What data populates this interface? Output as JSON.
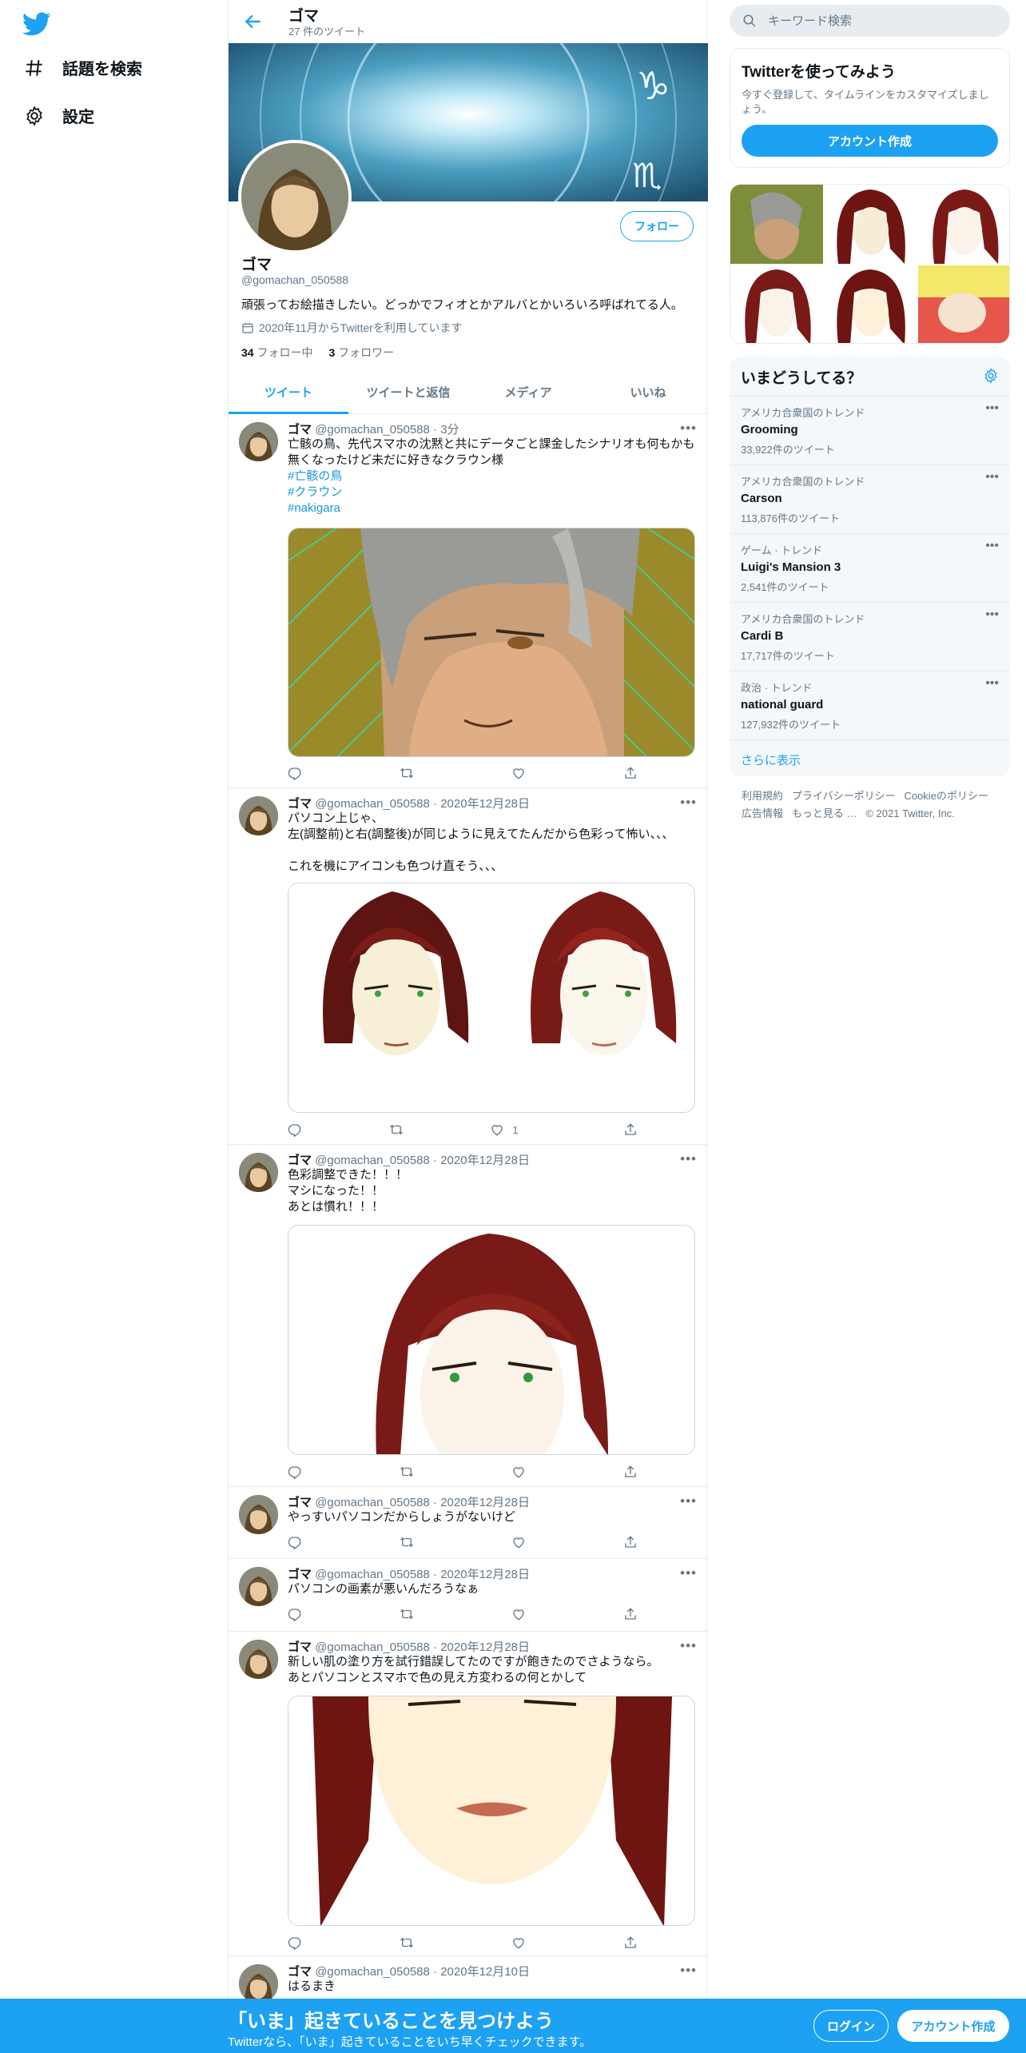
{
  "nav": {
    "search_label": "話題を検索",
    "settings_label": "設定"
  },
  "profile": {
    "name": "ゴマ",
    "tweet_count": "27 件のツイート",
    "handle": "@gomachan_050588",
    "bio": "頑張ってお絵描きしたい。どっかでフィオとかアルバとかいろいろ呼ばれてる人。",
    "joined": "2020年11月からTwitterを利用しています",
    "following_count": "34",
    "following_label": "フォロー中",
    "followers_count": "3",
    "followers_label": "フォロワー",
    "follow_button": "フォロー"
  },
  "tabs": [
    "ツイート",
    "ツイートと返信",
    "メディア",
    "いいね"
  ],
  "tweets": [
    {
      "name": "ゴマ",
      "handle": "@gomachan_050588",
      "time": "3分",
      "text": "亡骸の鳥、先代スマホの沈黙と共にデータごと課金したシナリオも何もかも無くなったけど未だに好きなクラウン様",
      "tags": [
        "#亡骸の鳥",
        "#クラウン",
        "#nakigara"
      ],
      "likes": ""
    },
    {
      "name": "ゴマ",
      "handle": "@gomachan_050588",
      "time": "2020年12月28日",
      "text": "パソコン上じゃ、\n左(調整前)と右(調整後)が同じように見えてたんだから色彩って怖い、、、\n\nこれを機にアイコンも色つけ直そう、、、",
      "likes": "1"
    },
    {
      "name": "ゴマ",
      "handle": "@gomachan_050588",
      "time": "2020年12月28日",
      "text": "色彩調整できた！！！\nマシになった！！\nあとは慣れ！！！",
      "likes": ""
    },
    {
      "name": "ゴマ",
      "handle": "@gomachan_050588",
      "time": "2020年12月28日",
      "text": "やっすいパソコンだからしょうがないけど",
      "likes": ""
    },
    {
      "name": "ゴマ",
      "handle": "@gomachan_050588",
      "time": "2020年12月28日",
      "text": "パソコンの画素が悪いんだろうなぁ",
      "likes": ""
    },
    {
      "name": "ゴマ",
      "handle": "@gomachan_050588",
      "time": "2020年12月28日",
      "text": "新しい肌の塗り方を試行錯誤してたのですが飽きたのでさようなら。\nあとパソコンとスマホで色の見え方変わるの何とかして",
      "likes": ""
    },
    {
      "name": "ゴマ",
      "handle": "@gomachan_050588",
      "time": "2020年12月10日",
      "text": "はるまき",
      "likes": ""
    }
  ],
  "search": {
    "placeholder": "キーワード検索"
  },
  "signup": {
    "title": "Twitterを使ってみよう",
    "desc": "今すぐ登録して、タイムラインをカスタマイズしましょう。",
    "button": "アカウント作成"
  },
  "trends": {
    "title": "いまどうしてる？",
    "items": [
      {
        "context": "アメリカ合衆国のトレンド",
        "title": "Grooming",
        "count": "33,922件のツイート"
      },
      {
        "context": "アメリカ合衆国のトレンド",
        "title": "Carson",
        "count": "113,876件のツイート"
      },
      {
        "context": "ゲーム · トレンド",
        "title": "Luigi's Mansion 3",
        "count": "2,541件のツイート"
      },
      {
        "context": "アメリカ合衆国のトレンド",
        "title": "Cardi B",
        "count": "17,717件のツイート"
      },
      {
        "context": "政治 · トレンド",
        "title": "national guard",
        "count": "127,932件のツイート"
      }
    ],
    "more": "さらに表示"
  },
  "footer": {
    "terms": "利用規約",
    "privacy": "プライバシーポリシー",
    "cookie": "Cookieのポリシー",
    "ads": "広告情報",
    "more": "もっと見る",
    "copyright": "© 2021 Twitter, Inc."
  },
  "bottom": {
    "title": "「いま」起きていることを見つけよう",
    "subtitle": "Twitterなら、「いま」起きていることをいち早くチェックできます。",
    "login": "ログイン",
    "signup": "アカウント作成"
  },
  "colors": {
    "accent": "#1da1f2",
    "text": "#0f1419",
    "muted": "#657786",
    "border": "#e6ecf0"
  }
}
